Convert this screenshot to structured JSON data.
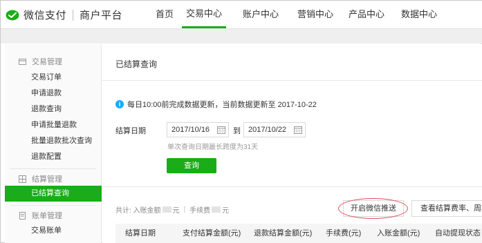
{
  "header": {
    "brand": "微信支付",
    "platform": "商户平台",
    "nav": [
      {
        "label": "首页",
        "active": false
      },
      {
        "label": "交易中心",
        "active": true
      },
      {
        "label": "账户中心",
        "active": false
      },
      {
        "label": "营销中心",
        "active": false
      },
      {
        "label": "产品中心",
        "active": false
      },
      {
        "label": "数据中心",
        "active": false
      }
    ]
  },
  "sidebar": {
    "groups": [
      {
        "title": "交易管理",
        "icon": "card-icon",
        "items": [
          "交易订单",
          "申请退款",
          "退款查询",
          "申请批量退款",
          "批量退款批次查询",
          "退款配置"
        ]
      },
      {
        "title": "结算管理",
        "icon": "grid-icon",
        "items": [
          "已结算查询"
        ]
      },
      {
        "title": "账单管理",
        "icon": "document-icon",
        "items": [
          "交易账单"
        ]
      }
    ],
    "active_item": "已结算查询"
  },
  "main": {
    "title": "已结算查询",
    "notice": "每日10:00前完成数据更新，当前数据更新至 2017-10-22",
    "date_label": "结算日期",
    "start_date": "2017/10/16",
    "to_label": "到",
    "end_date": "2017/10/22",
    "hint": "单次查询日期最长跨度为31天",
    "query_button": "查询",
    "summary": {
      "total_label": "共计: 入账金额",
      "amount_unit": "元",
      "fee_label": "手续费",
      "fee_unit": "元"
    },
    "push_button": "开启微信推送",
    "rate_button": "查看结算费率、周期",
    "table_headers": [
      "结算日期",
      "支付结算金额(元)",
      "退款结算金额(元)",
      "手续费(元)",
      "入账金额(元)",
      "自动提现状态"
    ]
  },
  "colors": {
    "accent": "#1aad19",
    "info": "#10aeff",
    "highlight": "#e0505a"
  }
}
